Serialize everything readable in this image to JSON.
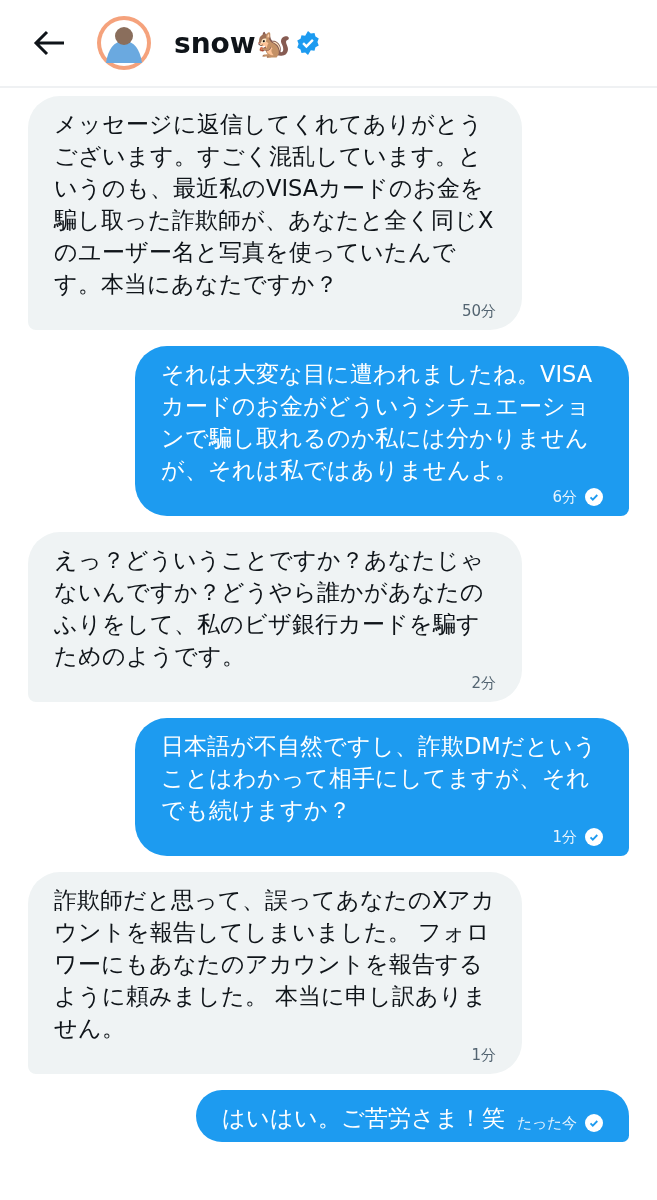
{
  "header": {
    "name": "snow🐿️",
    "verified": true
  },
  "messages": [
    {
      "kind": "received",
      "text": "メッセージに返信してくれてありがとうございます。すごく混乱しています。というのも、最近私のVISAカードのお金を騙し取った詐欺師が、あなたと全く同じXのユーザー名と写真を使っていたんです。本当にあなたですか？",
      "time": "50分"
    },
    {
      "kind": "sent",
      "text": "それは大変な目に遭われましたね。VISAカードのお金がどういうシチュエーションで騙し取れるのか私には分かりませんが、それは私ではありませんよ。",
      "time": "6分",
      "read": true
    },
    {
      "kind": "received",
      "text": "えっ？どういうことですか？あなたじゃないんですか？どうやら誰かがあなたのふりをして、私のビザ銀行カードを騙すためのようです。",
      "time": "2分"
    },
    {
      "kind": "sent",
      "text": "日本語が不自然ですし、詐欺DMだということはわかって相手にしてますが、それでも続けますか？",
      "time": "1分",
      "read": true
    },
    {
      "kind": "received",
      "text": "詐欺師だと思って、誤ってあなたのXアカウントを報告してしまいました。 フォロワーにもあなたのアカウントを報告するように頼みました。 本当に申し訳ありません。",
      "time": "1分"
    },
    {
      "kind": "sent",
      "text": "はいはい。ご苦労さま！笑",
      "time": "たった今",
      "read": true
    }
  ]
}
